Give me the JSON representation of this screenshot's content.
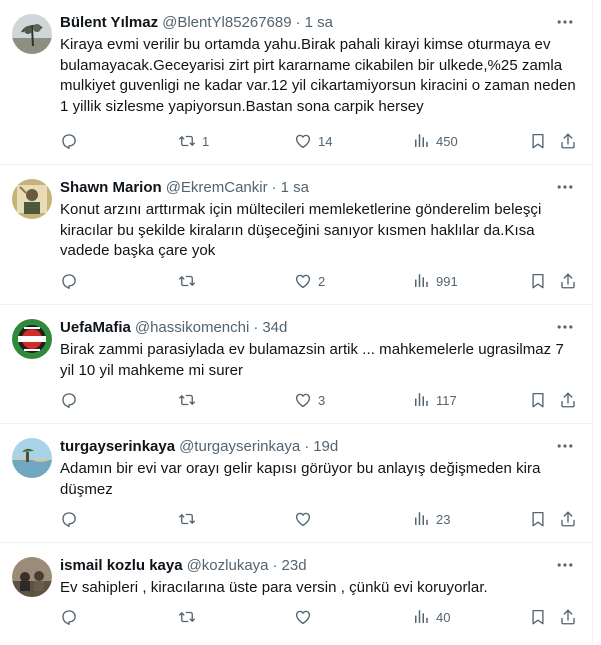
{
  "tweets": [
    {
      "name": "Bülent Yılmaz",
      "handle": "@BlentYl85267689",
      "time": "1 sa",
      "text": "Kiraya evmi verilir bu ortamda yahu.Birak pahali kirayi kimse oturmaya ev bulamayacak.Geceyarisi zirt pirt kararname cikabilen bir ulkede,%25 zamla mulkiyet guvenligi ne kadar var.12 yil cikartamiyorsun kiracini o zaman neden 1 yillik sizlesme yapiyorsun.Bastan sona carpik hersey",
      "replies": "",
      "retweets": "1",
      "likes": "14",
      "views": "450"
    },
    {
      "name": "Shawn Marion",
      "handle": "@EkremCankir",
      "time": "1 sa",
      "text": "Konut arzını arttırmak için mültecileri memleketlerine gönderelim beleşçi kiracılar bu şekilde kiraların düşeceğini sanıyor kısmen haklılar da.Kısa vadede başka çare yok",
      "replies": "",
      "retweets": "",
      "likes": "2",
      "views": "991"
    },
    {
      "name": "UefaMafia",
      "handle": "@hassikomenchi",
      "time": "34d",
      "text": "Birak zammi parasiylada ev bulamazsin artik ... mahkemelerle ugrasilmaz 7 yil 10 yil mahkeme mi surer",
      "replies": "",
      "retweets": "",
      "likes": "3",
      "views": "117"
    },
    {
      "name": "turgayserinkaya",
      "handle": "@turgayserinkaya",
      "time": "19d",
      "text": "Adamın bir evi var orayı gelir kapısı görüyor bu anlayış değişmeden kira düşmez",
      "replies": "",
      "retweets": "",
      "likes": "",
      "views": "23"
    },
    {
      "name": "ismail kozlu kaya",
      "handle": "@kozlukaya",
      "time": "23d",
      "text": "Ev sahipleri , kiracılarına üste para versin , çünkü evi koruyorlar.",
      "replies": "",
      "retweets": "",
      "likes": "",
      "views": "40"
    }
  ],
  "separator": "·",
  "colors": {
    "text": "#0f1419",
    "secondary": "#536471",
    "border": "#eff3f4",
    "background": "#ffffff"
  },
  "icons": {
    "reply": "reply-icon",
    "retweet": "retweet-icon",
    "like": "heart-icon",
    "views": "views-icon",
    "bookmark": "bookmark-icon",
    "share": "share-icon",
    "more": "more-icon"
  }
}
